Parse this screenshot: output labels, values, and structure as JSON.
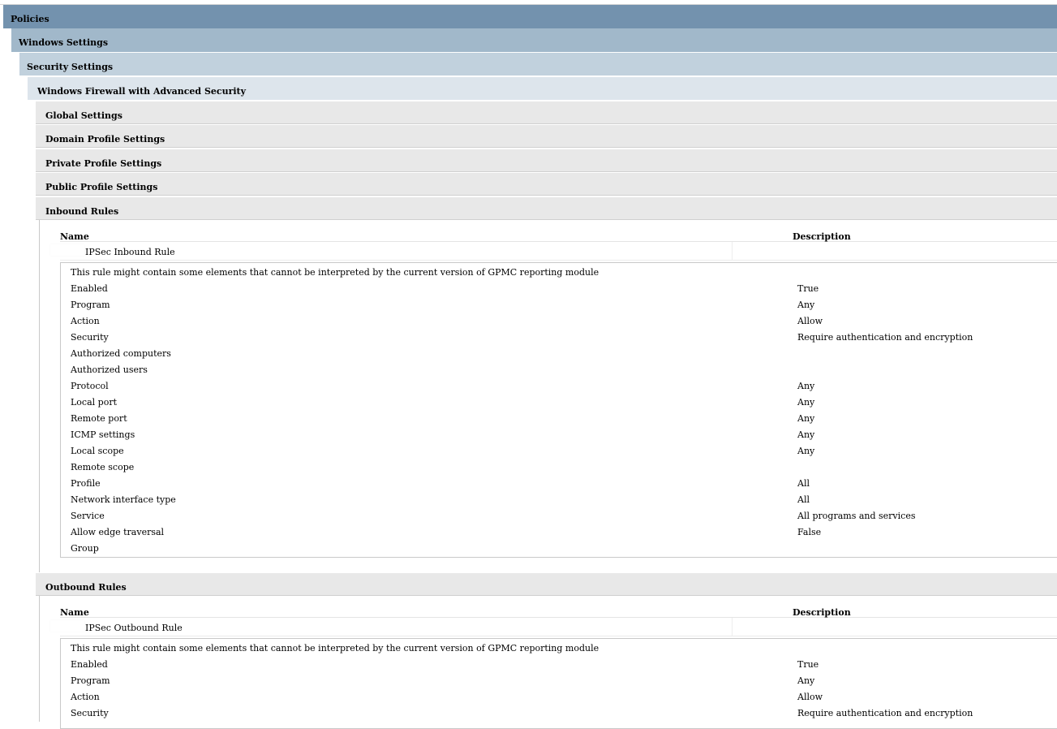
{
  "sections": {
    "policies": "Policies",
    "windows_settings": "Windows Settings",
    "security_settings": "Security Settings",
    "firewall": "Windows Firewall with Advanced Security",
    "global": "Global Settings",
    "domain_profile": "Domain Profile Settings",
    "private_profile": "Private Profile Settings",
    "public_profile": "Public Profile Settings",
    "inbound_rules": "Inbound Rules",
    "outbound_rules": "Outbound Rules"
  },
  "columns": {
    "name": "Name",
    "description": "Description"
  },
  "inbound": {
    "rule_name": "IPSec Inbound Rule",
    "note": "This rule might contain some elements that cannot be interpreted by the current version of GPMC reporting module",
    "rows": [
      {
        "k": "Enabled",
        "v": "True"
      },
      {
        "k": "Program",
        "v": "Any"
      },
      {
        "k": "Action",
        "v": "Allow"
      },
      {
        "k": "Security",
        "v": "Require authentication and encryption"
      },
      {
        "k": "Authorized computers",
        "v": ""
      },
      {
        "k": "Authorized users",
        "v": ""
      },
      {
        "k": "Protocol",
        "v": "Any"
      },
      {
        "k": "Local port",
        "v": "Any"
      },
      {
        "k": "Remote port",
        "v": "Any"
      },
      {
        "k": "ICMP settings",
        "v": "Any"
      },
      {
        "k": "Local scope",
        "v": "Any"
      },
      {
        "k": "Remote scope",
        "v": ""
      },
      {
        "k": "Profile",
        "v": "All"
      },
      {
        "k": "Network interface type",
        "v": "All"
      },
      {
        "k": "Service",
        "v": "All programs and services"
      },
      {
        "k": "Allow edge traversal",
        "v": "False"
      },
      {
        "k": "Group",
        "v": ""
      }
    ]
  },
  "outbound": {
    "rule_name": "IPSec Outbound Rule",
    "note": "This rule might contain some elements that cannot be interpreted by the current version of GPMC reporting module",
    "rows": [
      {
        "k": "Enabled",
        "v": "True"
      },
      {
        "k": "Program",
        "v": "Any"
      },
      {
        "k": "Action",
        "v": "Allow"
      },
      {
        "k": "Security",
        "v": "Require authentication and encryption"
      }
    ]
  }
}
